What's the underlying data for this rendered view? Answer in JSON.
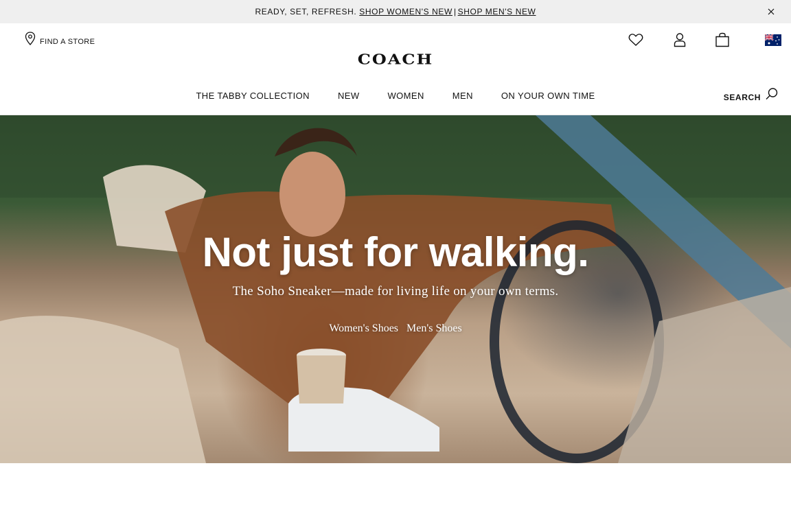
{
  "promo": {
    "text": "READY, SET, REFRESH.",
    "link_women": "SHOP WOMEN'S NEW",
    "separator": "|",
    "link_men": "SHOP MEN'S NEW"
  },
  "header": {
    "find_store": "FIND A STORE",
    "logo": "COACH",
    "search_label": "SEARCH",
    "icons": [
      "location-pin-icon",
      "heart-icon",
      "user-icon",
      "shopping-bag-icon",
      "australia-flag-icon",
      "search-icon",
      "close-icon"
    ]
  },
  "nav": {
    "items": [
      {
        "label": "THE TABBY COLLECTION"
      },
      {
        "label": "NEW"
      },
      {
        "label": "WOMEN"
      },
      {
        "label": "MEN"
      },
      {
        "label": "ON YOUR OWN TIME"
      }
    ]
  },
  "hero": {
    "title": "Not just for walking.",
    "subtitle": "The Soho Sneaker—made for living life on your own terms.",
    "links": [
      {
        "label": "Women's Shoes"
      },
      {
        "label": "Men's Shoes"
      }
    ]
  },
  "colors": {
    "promo_bg": "#efefef",
    "text": "#111111",
    "hero_text": "#ffffff"
  }
}
